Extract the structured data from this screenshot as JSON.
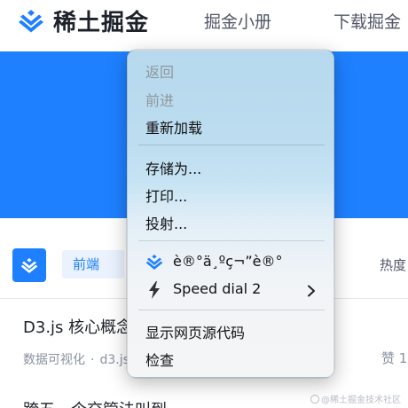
{
  "brand": {
    "name": "稀土掘金",
    "accent_color": "#1e80ff",
    "logo_icon": "juejin-logo-icon"
  },
  "nav": {
    "items": [
      "掘金小册",
      "下载掘金"
    ]
  },
  "category": {
    "icon": "juejin-logo-icon",
    "active_tag": "前端",
    "sort_label": "热度"
  },
  "article": {
    "title": "D3.js 核心概念",
    "meta_tag": "数据可视化",
    "meta_separator": "·",
    "meta_source": "d3.js",
    "likes_label": "赞 1",
    "next_title": "跨五一个交管法叫到"
  },
  "context_menu": {
    "back": "返回",
    "forward": "前进",
    "reload": "重新加载",
    "save_as": "存储为...",
    "print": "打印...",
    "cast": "投射...",
    "extension_item": "è®°ä¸ºç¬”è®°",
    "extension_icon": "juejin-logo-icon",
    "speed_dial": "Speed dial 2",
    "speed_dial_icon": "lightning-icon",
    "speed_dial_arrow": "chevron-right-icon",
    "view_source": "显示网页源代码",
    "inspect": "检查"
  },
  "watermark": {
    "text": "@稀土掘金技术社区"
  }
}
